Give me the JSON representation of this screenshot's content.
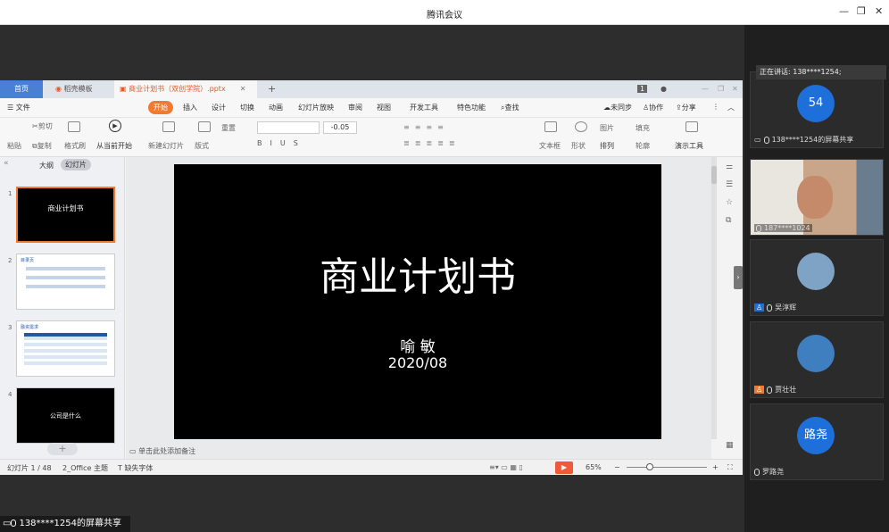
{
  "window": {
    "title": "腾讯会议",
    "min_icon": "—",
    "restore_icon": "❐",
    "close_icon": "✕"
  },
  "wps": {
    "tabs": [
      {
        "label": "首页"
      },
      {
        "label": "稻壳模板"
      },
      {
        "label": "商业计划书（双创学院）.pptx"
      }
    ],
    "tab_add": "+",
    "page_count_badge": "1",
    "menu": {
      "file": "文件",
      "items": [
        "开始",
        "插入",
        "设计",
        "切换",
        "动画",
        "幻灯片放映",
        "审阅",
        "视图",
        "开发工具",
        "特色功能"
      ],
      "search": "查找",
      "sync": "未同步",
      "collab": "协作",
      "share": "分享"
    },
    "toolbar": {
      "paste": "粘贴",
      "cut": "剪切",
      "copy": "复制",
      "format_painter": "格式刷",
      "play_from_current": "从当前开始",
      "new_slide": "新建幻灯片",
      "layout": "版式",
      "reset": "重置",
      "font_size_delta": "-0.05",
      "textbox": "文本框",
      "shape": "形状",
      "arrange": "排列",
      "picture": "图片",
      "fill": "填充",
      "outline": "轮廓",
      "presenter_tools": "演示工具"
    },
    "left_panel": {
      "tab_outline": "大纲",
      "tab_slides": "幻灯片",
      "thumbs": [
        {
          "num": "1",
          "title": "商业计划书"
        },
        {
          "num": "2",
          "title": "目录页"
        },
        {
          "num": "3",
          "title": "融资需求"
        },
        {
          "num": "4",
          "title": "公司是什么"
        }
      ],
      "add_label": "+"
    },
    "slide": {
      "title": "商业计划书",
      "author": "喻  敏",
      "date": "2020/08"
    },
    "notes_placeholder": "单击此处添加备注",
    "status": {
      "slide_pos": "幻灯片 1 / 48",
      "theme": "2_Office 主题",
      "missing_font": "缺失字体",
      "zoom": "65%",
      "zoom_minus": "−",
      "zoom_plus": "+"
    }
  },
  "meeting": {
    "speaking": "正在讲话: 138****1254;",
    "participants": [
      {
        "name": "138****1254的屏幕共享",
        "avatar_text": "54",
        "avatar_color": "#1e6fd9"
      },
      {
        "name": "187****1024",
        "avatar_text": "",
        "avatar_color": "#6a7d8f"
      },
      {
        "name": "吴淳辉",
        "avatar_text": "",
        "avatar_color": "#7fa3c4"
      },
      {
        "name": "贾壮壮",
        "avatar_text": "",
        "avatar_color": "#3f7fbf"
      },
      {
        "name": "罗路尧",
        "avatar_text": "路尧",
        "avatar_color": "#1e6fd9"
      }
    ],
    "share_label": "138****1254的屏幕共享"
  }
}
